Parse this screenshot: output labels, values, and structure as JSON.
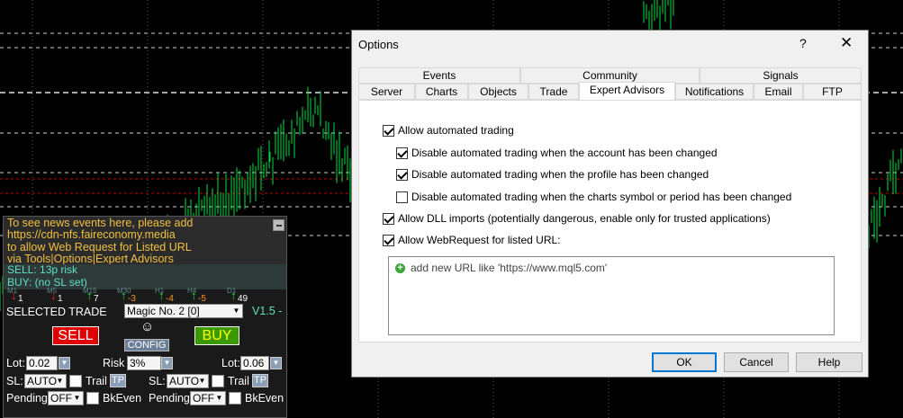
{
  "news": {
    "lines": [
      "To see news events here, please add",
      "https://cdn-nfs.faireconomy.media",
      "to allow Web Request for Listed URL",
      "via Tools|Options|Expert Advisors"
    ]
  },
  "risk": {
    "sell": "SELL: 13p risk",
    "buy": "BUY: (no SL set)"
  },
  "timeframes": [
    {
      "label": "M1",
      "value": "1",
      "dir": "down"
    },
    {
      "label": "M5",
      "value": "1",
      "dir": "down"
    },
    {
      "label": "M15",
      "value": "7",
      "dir": "up"
    },
    {
      "label": "M30",
      "value": "-3",
      "dir": "up"
    },
    {
      "label": "H1",
      "value": "-4",
      "dir": "up"
    },
    {
      "label": "H4",
      "value": "-5",
      "dir": "up"
    },
    {
      "label": "D1",
      "value": "49",
      "dir": "up"
    }
  ],
  "panel": {
    "selected_label": "SELECTED TRADE",
    "magic_value": "Magic No. 2 [0]",
    "version": "V1.5 -",
    "sell_label": "SELL",
    "buy_label": "BUY",
    "config_label": "CONFIG",
    "smile": "☺",
    "lot_label": "Lot:",
    "lot_left": "0.02",
    "risk_label": "Risk",
    "risk_value": "3%",
    "lot_right": "0.06",
    "sl_label": "SL:",
    "sl_left": "AUTO",
    "sl_right": "AUTO",
    "trail_label": "Trail",
    "tp_label": "TP",
    "pending_label": "Pending",
    "pending_left": "OFF",
    "pending_right": "OFF",
    "bkeven_label": "BkEven"
  },
  "dialog": {
    "title": "Options",
    "help": "?",
    "close": "✕",
    "tabs_row1": [
      "Events",
      "Community",
      "Signals"
    ],
    "tabs_row2": [
      "Server",
      "Charts",
      "Objects",
      "Trade",
      "Expert Advisors",
      "Notifications",
      "Email",
      "FTP"
    ],
    "active_tab": "Expert Advisors",
    "options": [
      {
        "label": "Allow automated trading",
        "checked": true
      },
      {
        "label": "Disable automated trading when the account has been changed",
        "checked": true
      },
      {
        "label": "Disable automated trading when the profile has been changed",
        "checked": true
      },
      {
        "label": "Disable automated trading when the charts symbol or period has been changed",
        "checked": false
      },
      {
        "label": "Allow DLL imports (potentially dangerous, enable only for trusted applications)",
        "checked": true
      },
      {
        "label": "Allow WebRequest for listed URL:",
        "checked": true
      }
    ],
    "url_placeholder": "add new URL like 'https://www.mql5.com'",
    "ok": "OK",
    "cancel": "Cancel",
    "help_button": "Help"
  },
  "colors": {
    "candle": "#00e040",
    "grid": "#cfcfcf",
    "red_line": "#c00000",
    "sell": "#e00000",
    "buy": "#3a9a00"
  }
}
